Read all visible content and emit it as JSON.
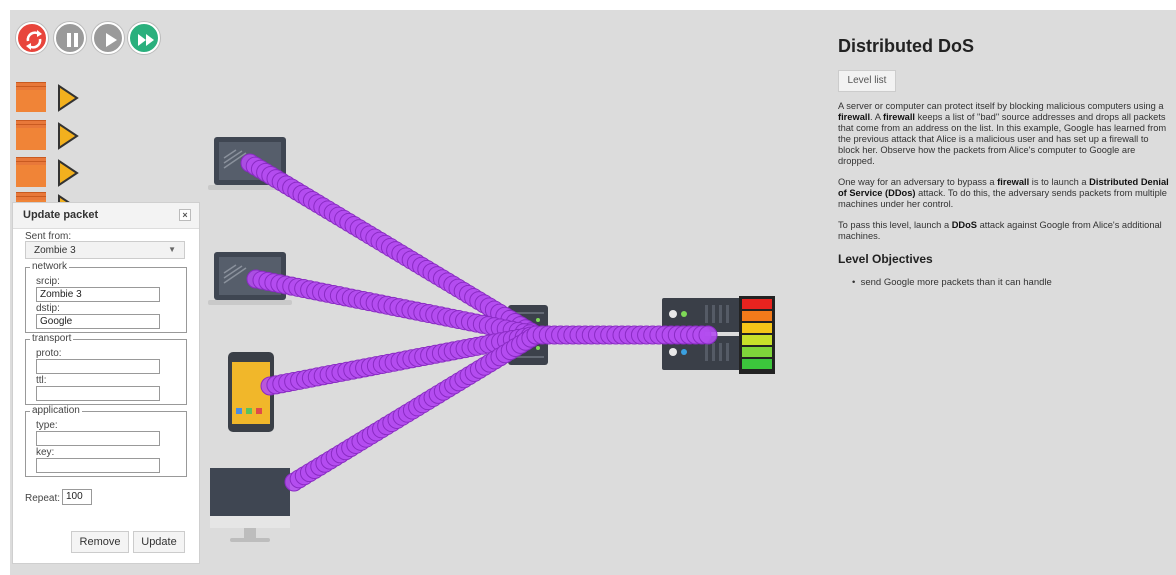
{
  "controls": [
    {
      "name": "reset",
      "color": "#e8453c"
    },
    {
      "name": "pause",
      "color": "#9a9a9a"
    },
    {
      "name": "play",
      "color": "#9a9a9a"
    },
    {
      "name": "fast-forward",
      "color": "#2ab07d"
    }
  ],
  "colors": {
    "packet": "#b44cf0",
    "queue": "#f08437",
    "queue_arrow": "#f2b01e"
  },
  "update_packet": {
    "title": "Update packet",
    "close_label": "×",
    "sent_from_label": "Sent from:",
    "sent_from_value": "Zombie 3",
    "network_legend": "network",
    "srcip_label": "srcip:",
    "srcip_value": "Zombie 3",
    "dstip_label": "dstip:",
    "dstip_value": "Google",
    "transport_legend": "transport",
    "proto_label": "proto:",
    "proto_value": "",
    "ttl_label": "ttl:",
    "ttl_value": "",
    "application_legend": "application",
    "type_label": "type:",
    "type_value": "",
    "key_label": "key:",
    "key_value": "",
    "repeat_label": "Repeat:",
    "repeat_value": "100",
    "remove_label": "Remove",
    "update_label": "Update"
  },
  "level": {
    "title": "Distributed DoS",
    "level_list_label": "Level list",
    "para1": [
      {
        "t": "A server or computer can protect itself by blocking malicious computers using a "
      },
      {
        "t": "firewall",
        "b": true
      },
      {
        "t": ". A "
      },
      {
        "t": "firewall",
        "b": true
      },
      {
        "t": " keeps a list of \"bad\" source addresses and drops all packets that come from an address on the list. In this example, Google has learned from the previous attack that Alice is a malicious user and has set up a firewall to block her. Observe how the packets from Alice's computer to Google are dropped."
      }
    ],
    "para2": [
      {
        "t": "One way for an adversary to bypass a "
      },
      {
        "t": "firewall",
        "b": true
      },
      {
        "t": " is to launch a "
      },
      {
        "t": "Distributed Denial of Service (DDos)",
        "b": true
      },
      {
        "t": " attack. To do this, the adversary sends packets from multiple machines under her control."
      }
    ],
    "para3": [
      {
        "t": "To pass this level, launch a "
      },
      {
        "t": "DDoS",
        "b": true
      },
      {
        "t": " attack against Google from Alice's additional machines."
      }
    ],
    "objectives_title": "Level Objectives",
    "objectives": [
      "send Google more packets than it can handle"
    ]
  },
  "server_load_colors": [
    "#e8231f",
    "#f27a1a",
    "#f5c518",
    "#c8e02a",
    "#7fd43a",
    "#3cc63c"
  ]
}
